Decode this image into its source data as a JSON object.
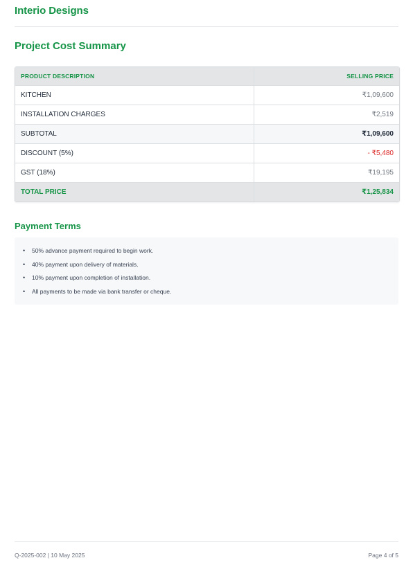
{
  "brand": {
    "name": "Interio Designs"
  },
  "summary": {
    "title": "Project Cost Summary",
    "headers": {
      "description": "PRODUCT DESCRIPTION",
      "price": "SELLING PRICE"
    },
    "rows": [
      {
        "description": "KITCHEN",
        "price": "₹1,09,600"
      },
      {
        "description": "INSTALLATION CHARGES",
        "price": "₹2,519"
      },
      {
        "description": "SUBTOTAL",
        "price": "₹1,09,600"
      },
      {
        "description": "DISCOUNT (5%)",
        "price": "- ₹5,480"
      },
      {
        "description": "GST (18%)",
        "price": "₹19,195"
      },
      {
        "description": "TOTAL PRICE",
        "price": "₹1,25,834"
      }
    ]
  },
  "payment_terms": {
    "title": "Payment Terms",
    "items": [
      "50% advance payment required to begin work.",
      "40% payment upon delivery of materials.",
      "10% payment upon completion of installation.",
      "All payments to be made via bank transfer or cheque."
    ]
  },
  "footer": {
    "reference": "Q-2025-002 | 10 May 2025",
    "page": "Page 4 of 5"
  },
  "colors": {
    "accent": "#159447",
    "discount": "#dc2626",
    "header_bg": "#e4e5e6",
    "terms_bg": "#f7f8fa"
  }
}
